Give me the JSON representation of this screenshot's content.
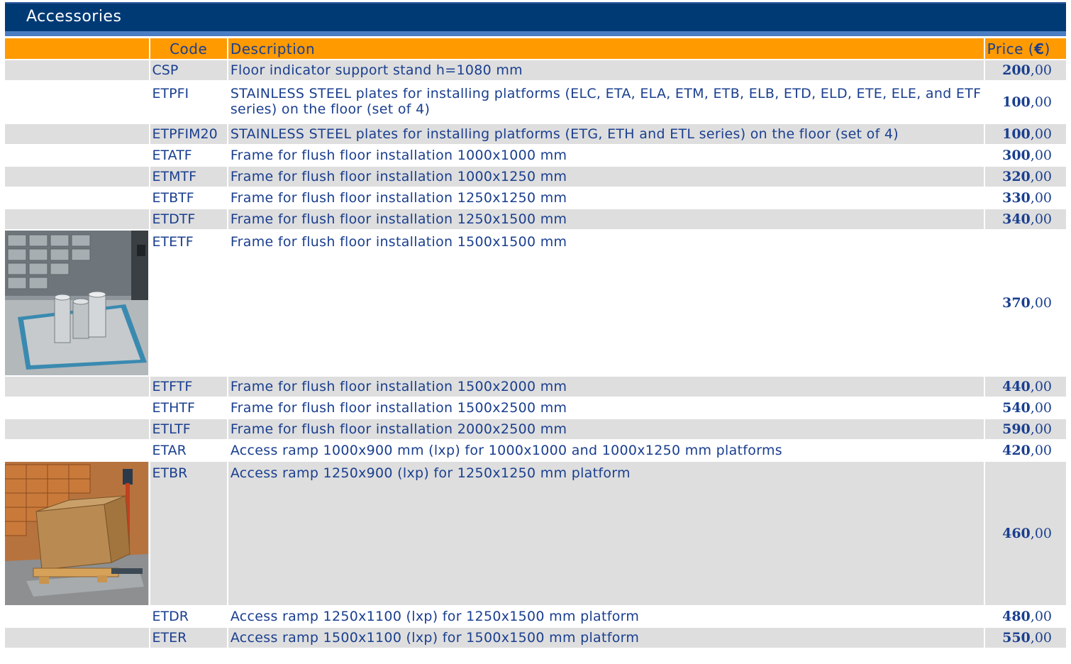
{
  "section_title": "Accessories",
  "columns": {
    "code": "Code",
    "description": "Description",
    "price_label": "Price (",
    "currency": "€",
    "price_close": ")"
  },
  "rows": [
    {
      "code": "CSP",
      "description": "Floor indicator support stand h=1080 mm",
      "price_int": "200",
      "price_dec": ",00"
    },
    {
      "code": "ETPFI",
      "description": "STAINLESS STEEL plates for installing platforms (ELC, ETA, ELA, ETM, ETB, ELB, ETD, ELD, ETE, ELE, and ETF series) on the floor (set of 4)",
      "price_int": "100",
      "price_dec": ",00"
    },
    {
      "code": "ETPFIM20",
      "description": "STAINLESS STEEL plates for installing platforms (ETG, ETH and ETL series) on the floor (set of 4)",
      "price_int": "100",
      "price_dec": ",00"
    },
    {
      "code": "ETATF",
      "description": "Frame for flush floor installation 1000x1000 mm",
      "price_int": "300",
      "price_dec": ",00"
    },
    {
      "code": "ETMTF",
      "description": "Frame for flush floor installation 1000x1250 mm",
      "price_int": "320",
      "price_dec": ",00"
    },
    {
      "code": "ETBTF",
      "description": "Frame for flush floor installation 1250x1250 mm",
      "price_int": "330",
      "price_dec": ",00"
    },
    {
      "code": "ETDTF",
      "description": "Frame for flush floor installation 1250x1500 mm",
      "price_int": "340",
      "price_dec": ",00"
    },
    {
      "code": "ETETF",
      "description": "Frame for flush floor installation 1500x1500 mm",
      "price_int": "370",
      "price_dec": ",00"
    },
    {
      "code": "ETFTF",
      "description": "Frame for flush floor installation 1500x2000 mm",
      "price_int": "440",
      "price_dec": ",00"
    },
    {
      "code": "ETHTF",
      "description": "Frame for flush floor installation 1500x2500 mm",
      "price_int": "540",
      "price_dec": ",00"
    },
    {
      "code": "ETLTF",
      "description": "Frame for flush floor installation 2000x2500 mm",
      "price_int": "590",
      "price_dec": ",00"
    },
    {
      "code": "ETAR",
      "description": "Access ramp 1000x900 mm (lxp) for 1000x1000 and 1000x1250 mm platforms",
      "price_int": "420",
      "price_dec": ",00"
    },
    {
      "code": "ETBR",
      "description": "Access ramp 1250x900 (lxp) for 1250x1250 mm platform",
      "price_int": "460",
      "price_dec": ",00"
    },
    {
      "code": "ETDR",
      "description": "Access ramp 1250x1100 (lxp) for 1250x1500 mm platform",
      "price_int": "480",
      "price_dec": ",00"
    },
    {
      "code": "ETER",
      "description": "Access ramp 1500x1100 (lxp) for 1500x1500 mm platform",
      "price_int": "550",
      "price_dec": ",00"
    }
  ],
  "images": [
    {
      "row": 7,
      "icon": "flush-frame-platform-photo"
    },
    {
      "row": 12,
      "icon": "access-ramp-pallet-photo"
    }
  ],
  "colors": {
    "header_bar": "#003a75",
    "column_header": "#ff9a00",
    "row_shade": "#dedede",
    "text": "#1a3f8f"
  }
}
